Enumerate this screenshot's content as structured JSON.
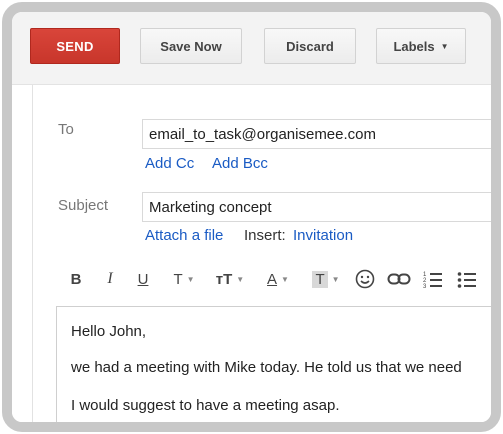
{
  "toolbar": {
    "send_label": "SEND",
    "save_label": "Save Now",
    "discard_label": "Discard",
    "labels_label": "Labels"
  },
  "compose": {
    "to_label": "To",
    "to_value": "email_to_task@organisemee.com",
    "add_cc": "Add Cc",
    "add_bcc": "Add Bcc",
    "subject_label": "Subject",
    "subject_value": "Marketing concept",
    "attach_file": "Attach a file",
    "insert_label": "Insert:",
    "invitation": "Invitation"
  },
  "format_toolbar": {
    "bold": "B",
    "italic": "I",
    "underline": "U",
    "font": "T",
    "size": "тT",
    "text_color": "A",
    "highlight": "T"
  },
  "body": {
    "lines": [
      "Hello John,",
      "we had a meeting with Mike today. He told us that we need",
      "I would suggest to have a meeting asap."
    ]
  },
  "colors": {
    "send": "#d13f33",
    "link": "#1a5bc4"
  },
  "icons": {
    "dropdown": "caret-down-icon",
    "emoji": "smiley-icon",
    "link": "link-icon",
    "numbered_list": "numbered-list-icon",
    "bulleted_list": "bulleted-list-icon"
  }
}
